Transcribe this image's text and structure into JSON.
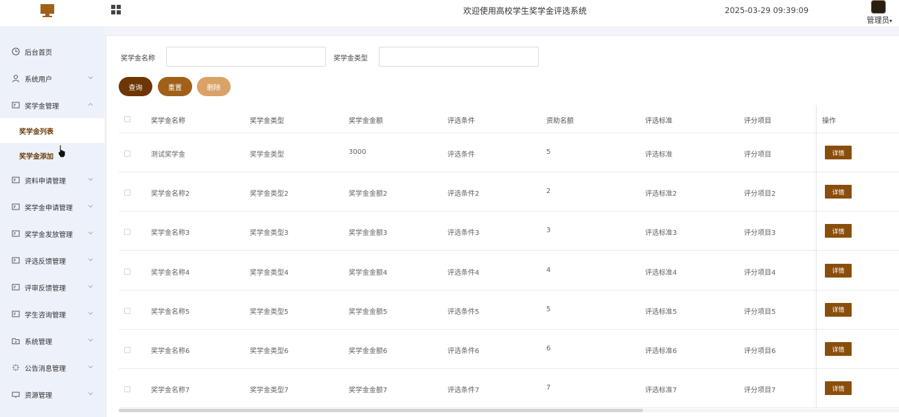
{
  "header": {
    "title": "欢迎使用高校学生奖学金评选系统",
    "datetime": "2025-03-29 09:39:09",
    "user": "管理员",
    "colors": {
      "accent": "#a0601a"
    }
  },
  "sidebar": {
    "items": [
      {
        "label": "后台首页",
        "icon": "clock-icon"
      },
      {
        "label": "系统用户",
        "icon": "user-icon"
      },
      {
        "label": "奖学金管理",
        "icon": "card-icon",
        "expanded": true
      },
      {
        "label": "资料申请管理",
        "icon": "card-icon"
      },
      {
        "label": "奖学金申请管理",
        "icon": "card-icon"
      },
      {
        "label": "奖学金发放管理",
        "icon": "card-icon"
      },
      {
        "label": "评选反馈管理",
        "icon": "card-icon"
      },
      {
        "label": "评审反馈管理",
        "icon": "card-icon"
      },
      {
        "label": "学生咨询管理",
        "icon": "card-icon"
      },
      {
        "label": "系统管理",
        "icon": "folder-icon"
      },
      {
        "label": "公告消息管理",
        "icon": "sparkle-icon"
      },
      {
        "label": "资源管理",
        "icon": "inbox-icon"
      }
    ],
    "submenu": [
      {
        "label": "奖学金列表",
        "active": true
      },
      {
        "label": "奖学金添加",
        "active": false
      }
    ]
  },
  "search": {
    "name_label": "奖学金名称",
    "name_value": "",
    "type_label": "奖学金类型",
    "type_value": "",
    "query_btn": "查询",
    "reset_btn": "重置",
    "delete_btn": "删除"
  },
  "table": {
    "columns": [
      "奖学金名称",
      "奖学金类型",
      "奖学金金额",
      "评选条件",
      "资助名额",
      "评选标准",
      "评分项目",
      "操作"
    ],
    "detail_label": "详情",
    "rows": [
      [
        "测试奖学金",
        "奖学金类型",
        "3000",
        "评选条件",
        "5",
        "评选标准",
        "评分项目"
      ],
      [
        "奖学金名称2",
        "奖学金类型2",
        "奖学金金额2",
        "评选条件2",
        "2",
        "评选标准2",
        "评分项目2"
      ],
      [
        "奖学金名称3",
        "奖学金类型3",
        "奖学金金额3",
        "评选条件3",
        "3",
        "评选标准3",
        "评分项目3"
      ],
      [
        "奖学金名称4",
        "奖学金类型4",
        "奖学金金额4",
        "评选条件4",
        "4",
        "评选标准4",
        "评分项目4"
      ],
      [
        "奖学金名称5",
        "奖学金类型5",
        "奖学金金额5",
        "评选条件5",
        "5",
        "评选标准5",
        "评分项目5"
      ],
      [
        "奖学金名称6",
        "奖学金类型6",
        "奖学金金额6",
        "评选条件6",
        "6",
        "评选标准6",
        "评分项目6"
      ],
      [
        "奖学金名称7",
        "奖学金类型7",
        "奖学金金额7",
        "评选条件7",
        "7",
        "评选标准7",
        "评分项目7"
      ]
    ]
  }
}
